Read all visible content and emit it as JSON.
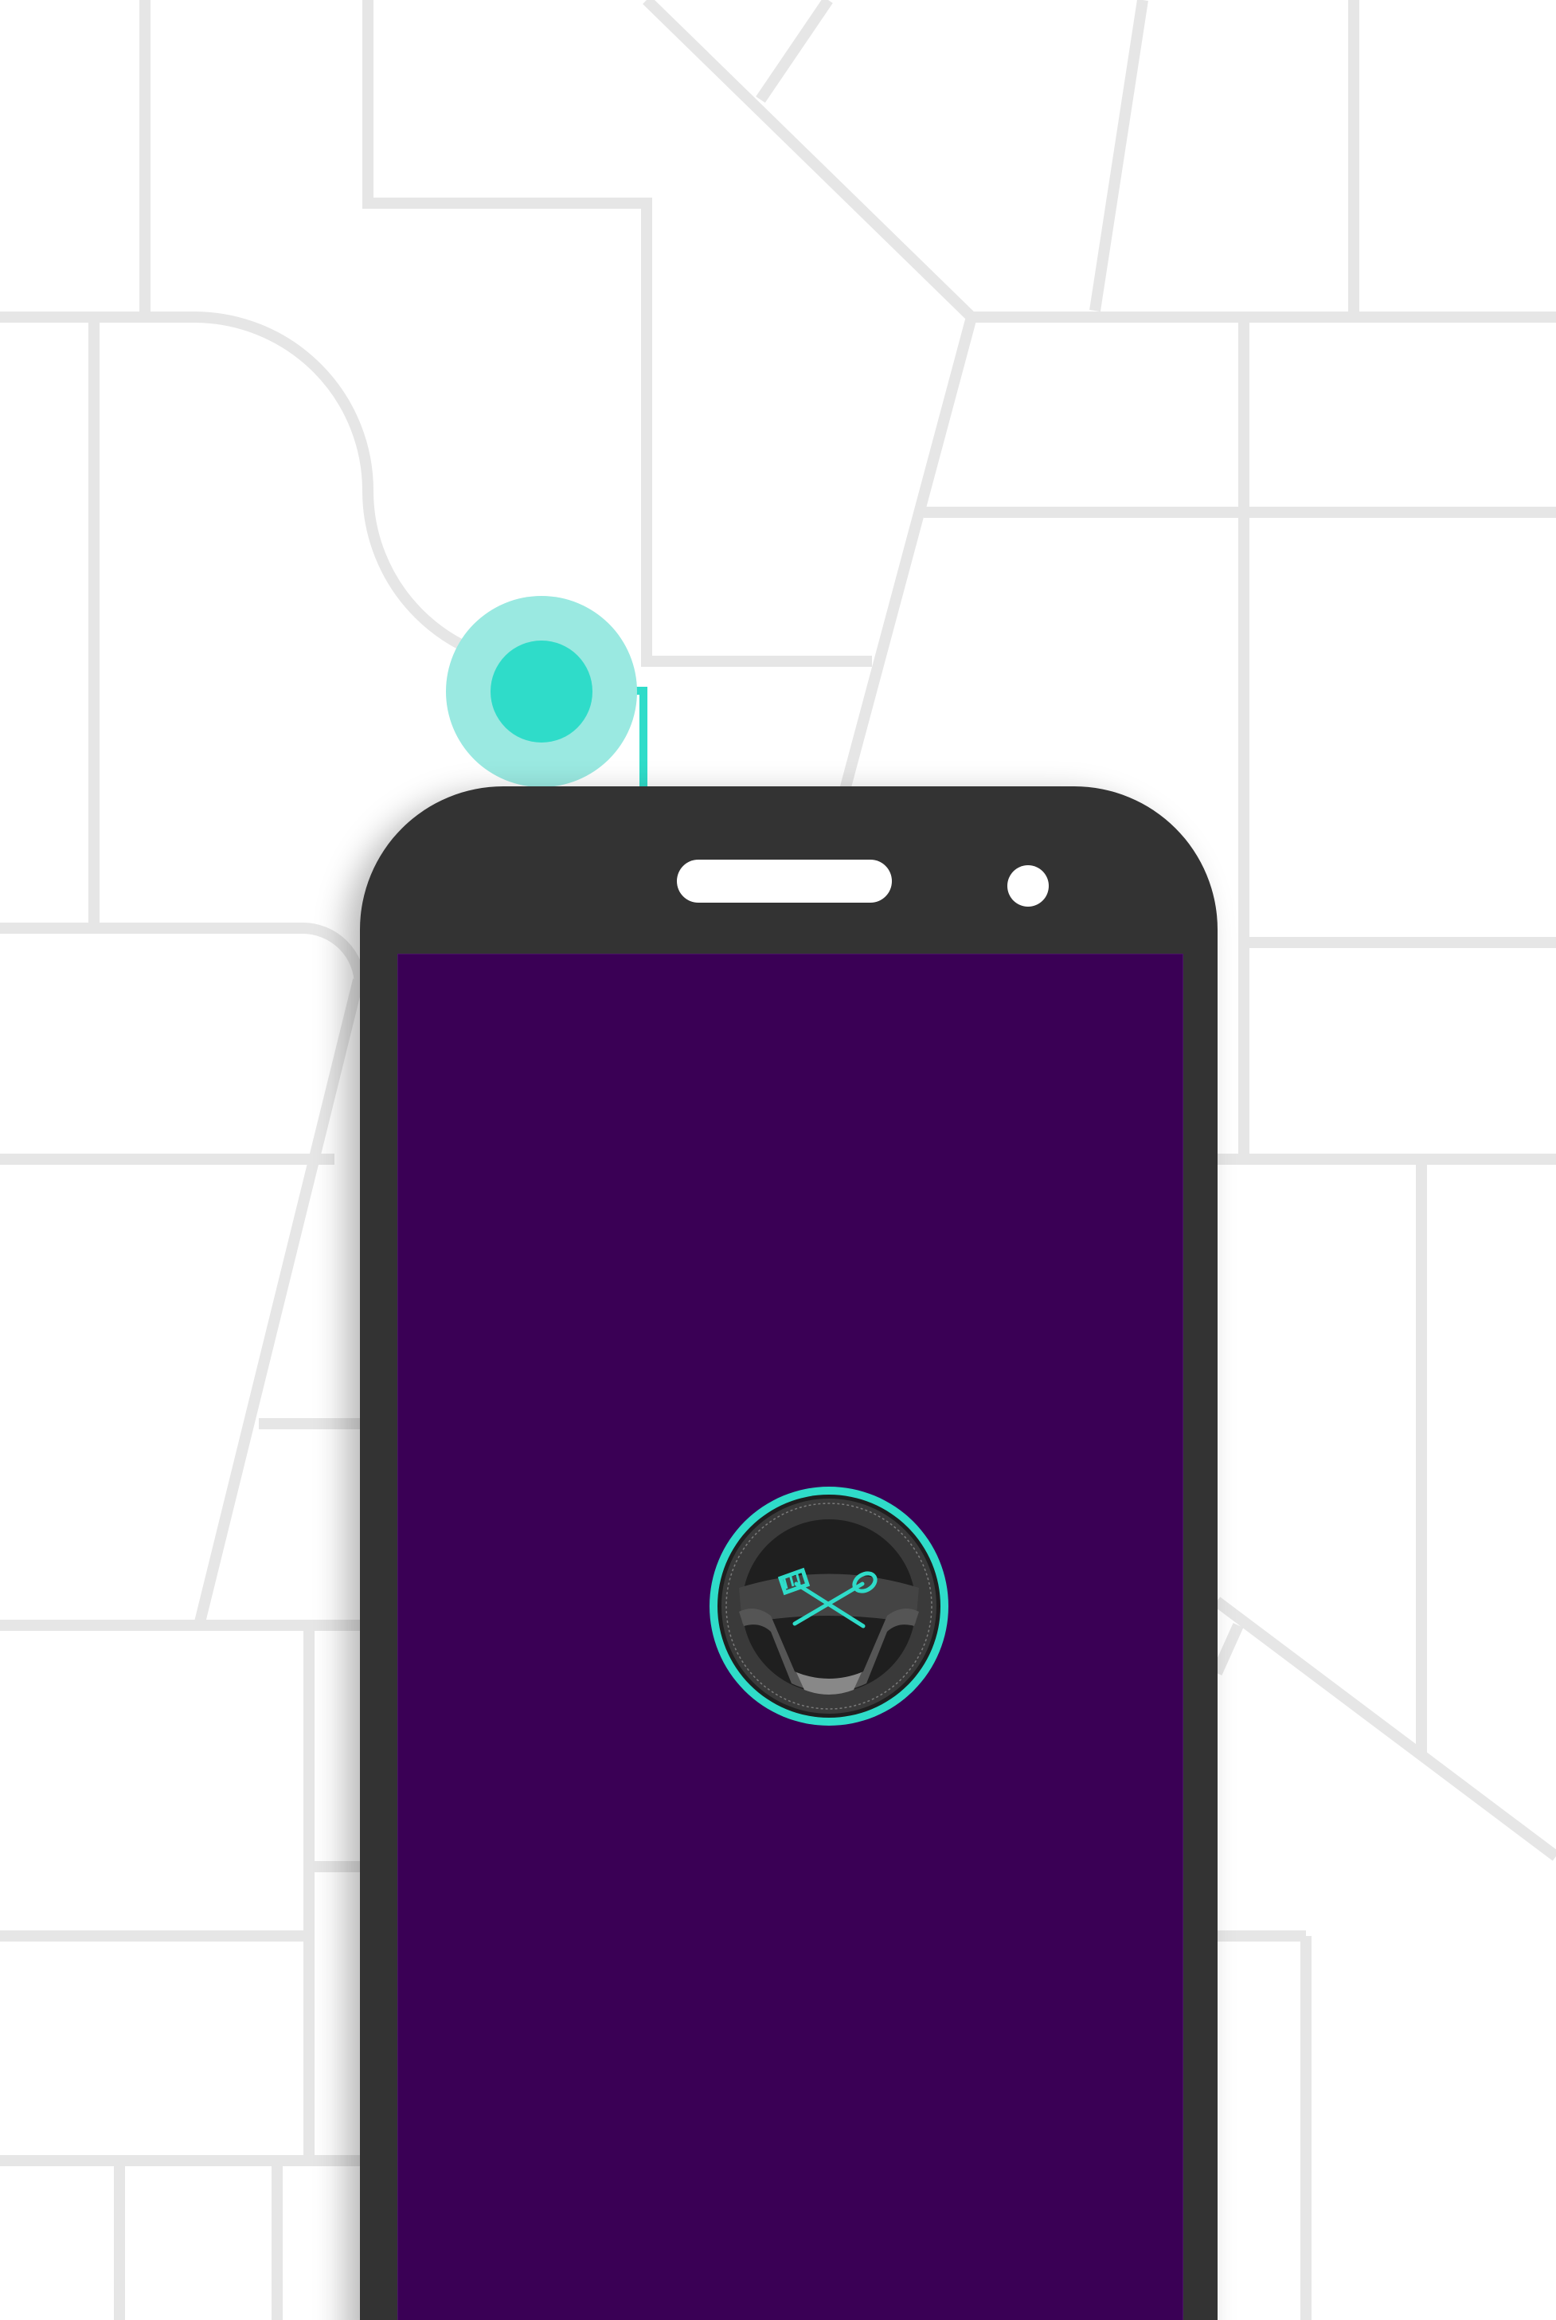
{
  "colors": {
    "background": "#ffffff",
    "map_lines": "#e6e6e6",
    "phone_body": "#333333",
    "screen": "#3a0055",
    "accent": "#2fdcc9",
    "accent_soft": "#9ae9e1"
  },
  "icons": {
    "location_pin": "location-pin-icon",
    "app_logo": "steering-wheel-with-fork-and-spoon-icon"
  },
  "screen_state": "splash"
}
